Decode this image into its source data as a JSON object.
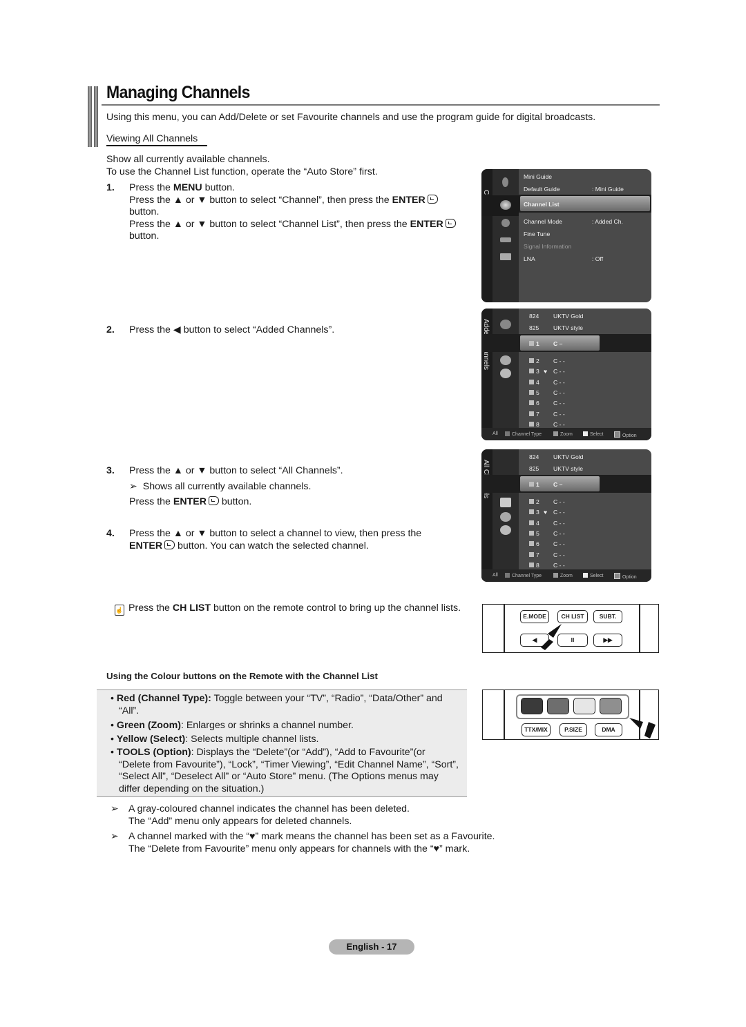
{
  "header": {
    "title": "Managing Channels",
    "intro": "Using this menu, you can Add/Delete or set Favourite channels and use the program guide for digital broadcasts."
  },
  "section": {
    "heading": "Viewing All Channels",
    "lines": [
      "Show all currently available channels.",
      "To use the Channel List function, operate the “Auto Store” first."
    ]
  },
  "steps": {
    "s1": {
      "num": "1.",
      "a_pre": "Press the ",
      "a_bold": "MENU",
      "a_post": " button.",
      "b_pre": "Press the ▲ or ▼ button to select “Channel”, then press the ",
      "b_bold": "ENTER",
      "b_post": "button.",
      "c_pre": "Press the ▲ or ▼ button to select “Channel List”, then press the ",
      "c_bold": "ENTER",
      "c_post": "button."
    },
    "s2": {
      "num": "2.",
      "text": "Press the ◀ button to select “Added Channels”."
    },
    "s3": {
      "num": "3.",
      "text": "Press the ▲ or ▼ button to select “All Channels”.",
      "note_arrow": "➢",
      "note": "Shows all currently available channels.",
      "enter_pre": "Press the ",
      "enter_bold": "ENTER",
      "enter_post": " button."
    },
    "s4": {
      "num": "4.",
      "text": "Press the ▲ or ▼ button to select a channel to view, then press the",
      "enter_bold": "ENTER",
      "text2": " button. You can watch the selected channel."
    }
  },
  "osd_menu": {
    "rail_label": "Channel",
    "items": [
      {
        "label": "Mini Guide",
        "value": ""
      },
      {
        "label": "Default Guide",
        "value": ": Mini Guide"
      },
      {
        "label": "Channel List",
        "value": ""
      },
      {
        "label": "Channel Mode",
        "value": ": Added Ch."
      },
      {
        "label": "Fine Tune",
        "value": ""
      },
      {
        "label": "Signal Information",
        "value": ""
      },
      {
        "label": "LNA",
        "value": ": Off"
      }
    ]
  },
  "osd_added": {
    "rail_label": "Added Channels",
    "top": [
      {
        "num": "824",
        "name": "UKTV Gold"
      },
      {
        "num": "825",
        "name": "UKTV style"
      }
    ],
    "channels": [
      {
        "num": "1",
        "fav": "",
        "name": "C –"
      },
      {
        "num": "2",
        "fav": "",
        "name": "C - -"
      },
      {
        "num": "3",
        "fav": "♥",
        "name": "C - -"
      },
      {
        "num": "4",
        "fav": "",
        "name": "C - -"
      },
      {
        "num": "5",
        "fav": "",
        "name": "C - -"
      },
      {
        "num": "6",
        "fav": "",
        "name": "C - -"
      },
      {
        "num": "7",
        "fav": "",
        "name": "C - -"
      },
      {
        "num": "8",
        "fav": "",
        "name": "C - -"
      }
    ],
    "footer": {
      "all": "All",
      "type": "Channel Type",
      "zoom": "Zoom",
      "select": "Select",
      "option": "Option"
    }
  },
  "osd_all": {
    "rail_label": "All Channels",
    "top": [
      {
        "num": "824",
        "name": "UKTV Gold"
      },
      {
        "num": "825",
        "name": "UKTV style"
      }
    ],
    "channels": [
      {
        "num": "1",
        "fav": "",
        "name": "C –"
      },
      {
        "num": "2",
        "fav": "",
        "name": "C - -"
      },
      {
        "num": "3",
        "fav": "♥",
        "name": "C - -"
      },
      {
        "num": "4",
        "fav": "",
        "name": "C - -"
      },
      {
        "num": "5",
        "fav": "",
        "name": "C - -"
      },
      {
        "num": "6",
        "fav": "",
        "name": "C - -"
      },
      {
        "num": "7",
        "fav": "",
        "name": "C - -"
      },
      {
        "num": "8",
        "fav": "",
        "name": "C - -"
      }
    ],
    "footer": {
      "all": "All",
      "type": "Channel Type",
      "zoom": "Zoom",
      "select": "Select",
      "option": "Option"
    }
  },
  "chlist_note": {
    "pre": "Press the ",
    "bold": "CH LIST",
    "post": " button on the remote control to bring up the channel lists."
  },
  "remote1": {
    "buttons": [
      "E.MODE",
      "CH LIST",
      "SUBT."
    ],
    "row2": [
      "◀",
      "II",
      "▶▶"
    ]
  },
  "colour_section": {
    "heading": "Using the Colour buttons on the Remote with the Channel List",
    "bullets": [
      {
        "bold": "Red (Channel Type):",
        "text": " Toggle between your “TV”, “Radio”, “Data/Other” and “All”."
      },
      {
        "bold": "Green (Zoom)",
        "text": ": Enlarges or shrinks a channel number."
      },
      {
        "bold": "Yellow (Select)",
        "text": ": Selects multiple channel lists."
      },
      {
        "bold": "TOOLS (Option)",
        "text": ": Displays the “Delete”(or “Add”), “Add to Favourite”(or “Delete from Favourite”), “Lock”, “Timer Viewing”, “Edit Channel Name”, “Sort”, “Select All”, “Deselect All” or “Auto Store” menu. (The Options menus may differ depending on the situation.)"
      }
    ]
  },
  "remote2": {
    "buttons": [
      "TTX/MIX",
      "P.SIZE",
      "DMA"
    ],
    "colour_keys": [
      "#3a3a3a",
      "#6e6e6e",
      "#e6e6e6",
      "#8f8f8f"
    ]
  },
  "notes": [
    {
      "arrow": "➢",
      "l1": "A gray-coloured channel indicates the channel has been deleted.",
      "l2": "The “Add” menu only appears for deleted channels."
    },
    {
      "arrow": "➢",
      "l1": "A channel marked with the “♥” mark means the channel has been set as a Favourite.",
      "l2": "The “Delete from Favourite” menu only appears for channels with the “♥” mark."
    }
  ],
  "page_footer": "English - 17"
}
